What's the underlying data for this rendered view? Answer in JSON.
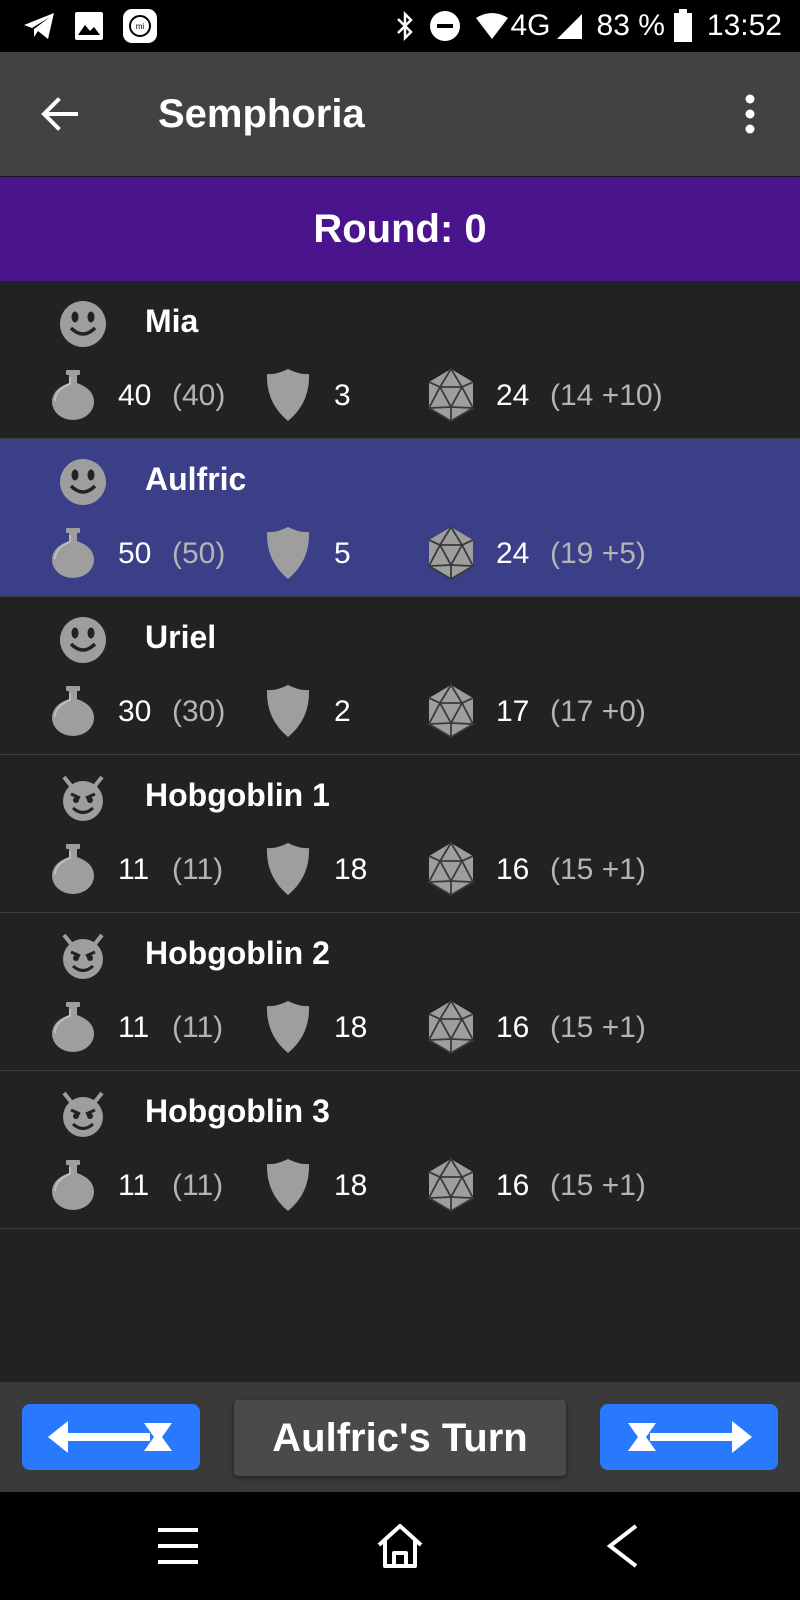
{
  "status_bar": {
    "battery": "83 %",
    "time": "13:52",
    "network": "4G",
    "left_icons": [
      "telegram-icon",
      "gallery-icon",
      "mi-icon"
    ],
    "right_icons": [
      "bluetooth-icon",
      "dnd-icon",
      "wifi-icon",
      "signal-icon",
      "battery-icon"
    ]
  },
  "app_bar": {
    "title": "Semphoria",
    "back_icon": "arrow-back-icon",
    "menu_icon": "more-vert-icon"
  },
  "round": {
    "label": "Round: 0"
  },
  "colors": {
    "round_bar": "#4a148c",
    "active_row": "#3a3f88",
    "nav_button": "#2979ff",
    "icon_gray": "#9e9e9e"
  },
  "combatants": [
    {
      "name": "Mia",
      "type": "player",
      "icon": "smiley-icon",
      "hp": "40",
      "max_hp": "(40)",
      "ac": "3",
      "initiative": "24",
      "initiative_detail": "(14 +10)",
      "active": false
    },
    {
      "name": "Aulfric",
      "type": "player",
      "icon": "smiley-icon",
      "hp": "50",
      "max_hp": "(50)",
      "ac": "5",
      "initiative": "24",
      "initiative_detail": "(19 +5)",
      "active": true
    },
    {
      "name": "Uriel",
      "type": "player",
      "icon": "smiley-icon",
      "hp": "30",
      "max_hp": "(30)",
      "ac": "2",
      "initiative": "17",
      "initiative_detail": "(17 +0)",
      "active": false
    },
    {
      "name": "Hobgoblin 1",
      "type": "monster",
      "icon": "devil-icon",
      "hp": "11",
      "max_hp": "(11)",
      "ac": "18",
      "initiative": "16",
      "initiative_detail": "(15 +1)",
      "active": false
    },
    {
      "name": "Hobgoblin 2",
      "type": "monster",
      "icon": "devil-icon",
      "hp": "11",
      "max_hp": "(11)",
      "ac": "18",
      "initiative": "16",
      "initiative_detail": "(15 +1)",
      "active": false
    },
    {
      "name": "Hobgoblin 3",
      "type": "monster",
      "icon": "devil-icon",
      "hp": "11",
      "max_hp": "(11)",
      "ac": "18",
      "initiative": "16",
      "initiative_detail": "(15 +1)",
      "active": false
    }
  ],
  "bottom_bar": {
    "turn_label": "Aulfric's Turn",
    "prev_icon": "arrow-left-icon",
    "next_icon": "arrow-right-icon"
  },
  "system_nav": [
    "menu-icon",
    "home-icon",
    "back-icon"
  ]
}
